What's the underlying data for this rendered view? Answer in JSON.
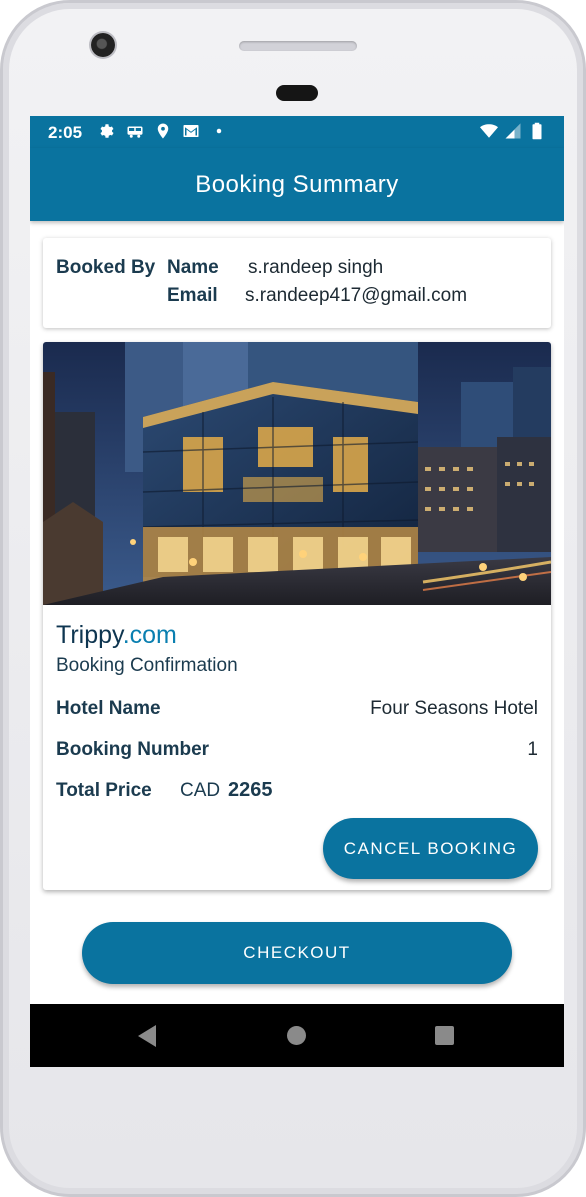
{
  "status_bar": {
    "time": "2:05",
    "icons_left": [
      "settings-icon",
      "car-icon",
      "location-icon",
      "gmail-icon",
      "dot-icon"
    ],
    "icons_right": [
      "wifi-icon",
      "signal-icon",
      "battery-icon"
    ]
  },
  "app_bar": {
    "title": "Booking Summary"
  },
  "booked_by": {
    "section_label": "Booked By",
    "name_label": "Name",
    "name_value": "s.randeep singh",
    "email_label": "Email",
    "email_value": "s.randeep417@gmail.com"
  },
  "booking": {
    "brand_main": "Trippy",
    "brand_suffix": ".com",
    "subtitle": "Booking Confirmation",
    "hotel_name_label": "Hotel Name",
    "hotel_name_value": "Four Seasons Hotel",
    "booking_number_label": "Booking Number",
    "booking_number_value": "1",
    "total_price_label": "Total Price",
    "currency": "CAD",
    "total_price_value": "2265",
    "cancel_button": "CANCEL BOOKING"
  },
  "checkout_button": "CHECKOUT",
  "colors": {
    "primary": "#0a739f",
    "brand_accent": "#0a7fb0",
    "text_dark": "#1b3b4f"
  }
}
